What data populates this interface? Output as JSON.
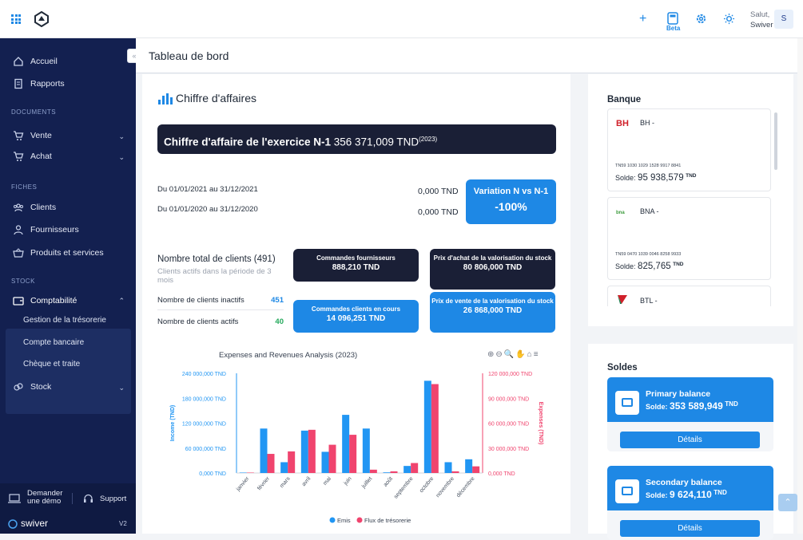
{
  "topbar": {
    "beta_label": "Beta",
    "greeting": "Salut,",
    "user_name": "Swiver",
    "avatar_initial": "S",
    "icons": [
      "apps-grid-icon",
      "swiver-logo",
      "plus-icon",
      "calculator-icon",
      "gear-icon",
      "sun-icon"
    ]
  },
  "sidebar": {
    "accueil": "Accueil",
    "rapports": "Rapports",
    "section_documents": "DOCUMENTS",
    "vente": "Vente",
    "achat": "Achat",
    "section_fiches": "FICHES",
    "clients": "Clients",
    "fournisseurs": "Fournisseurs",
    "produits": "Produits et services",
    "section_stock": "STOCK",
    "comptabilite": "Comptabilité",
    "sub_tresorerie": "Gestion de la trésorerie",
    "sub_compte": "Compte bancaire",
    "sub_cheque": "Chèque et traite",
    "stock": "Stock",
    "demo_line1": "Demander",
    "demo_line2": "une démo",
    "support": "Support",
    "brand": "swiver",
    "version": "V2",
    "collapse_glyph": "«"
  },
  "page": {
    "title": "Tableau de bord"
  },
  "chiffre": {
    "title": "Chiffre d'affaires",
    "banner_label": "Chiffre d'affaire de l'exercice N-1",
    "banner_amount": "356 371,009 TND",
    "banner_year": "(2023)",
    "period1": "Du 01/01/2021 au 31/12/2021",
    "period1_amount": "0,000 TND",
    "period2": "Du 01/01/2020 au 31/12/2020",
    "period2_amount": "0,000 TND",
    "variation_label": "Variation N vs N-1",
    "variation_value": "-100%"
  },
  "clients": {
    "title": "Nombre total de clients (491)",
    "subtitle": "Clients actifs dans la période de 3 mois",
    "inactive_label": "Nombre de clients inactifs",
    "inactive_value": "451",
    "active_label": "Nombre de clients actifs",
    "active_value": "40"
  },
  "kpis": {
    "cmd_fournisseurs_label": "Commandes fournisseurs",
    "cmd_fournisseurs_value": "888,210 TND",
    "prix_achat_label": "Prix d'achat de la valorisation du stock",
    "prix_achat_value": "80 806,000 TND",
    "cmd_clients_label": "Commandes clients en cours",
    "cmd_clients_value": "14 096,251 TND",
    "prix_vente_label": "Prix de vente de la valorisation du stock",
    "prix_vente_value": "26 868,000 TND"
  },
  "chart_tools": "⊕⊖🔍✋⌂≡",
  "chart_data": {
    "type": "bar",
    "title": "Expenses and Revenues Analysis (2023)",
    "categories": [
      "janvier",
      "février",
      "mars",
      "avril",
      "mai",
      "juin",
      "juillet",
      "août",
      "septembre",
      "octobre",
      "novembre",
      "décembre"
    ],
    "series": [
      {
        "name": "Emis",
        "axis": "left",
        "color": "#2196f3",
        "values": [
          1000000,
          107000000,
          26000000,
          102000000,
          51000000,
          140000000,
          107000000,
          1500000,
          17000000,
          222000000,
          26000000,
          33000000
        ]
      },
      {
        "name": "Flux de trésorerie",
        "axis": "right",
        "color": "#f0446e",
        "values": [
          500000,
          23000000,
          26000000,
          52000000,
          34000000,
          46000000,
          4000000,
          2000000,
          12000000,
          107000000,
          2000000,
          8000000
        ]
      }
    ],
    "ylabel": "Income (TND)",
    "y2label": "Expenses (TND)",
    "ylim": [
      0,
      240000000
    ],
    "y2lim": [
      0,
      120000000
    ],
    "yticks": [
      "0,000 TND",
      "60 000,000 TND",
      "120 000,000 TND",
      "180 000,000 TND",
      "240 000,000 TND"
    ],
    "y2ticks": [
      "0,000 TND",
      "30 000,000 TND",
      "60 000,000 TND",
      "90 000,000 TND",
      "120 000,000 TND"
    ],
    "legend": "bottom-center"
  },
  "banque": {
    "title": "Banque",
    "solde_label": "Solde:",
    "tnd": "TND",
    "banks": [
      {
        "logo": "BH",
        "name": "BH -",
        "rib": "TN59 1030 1029 1528 9917 8841",
        "solde": "95 938,579"
      },
      {
        "logo": "bna",
        "name": "BNA -",
        "rib": "TN59 0470 1039 0046 8258 9933",
        "solde": "825,765"
      },
      {
        "logo": "btl",
        "name": "BTL -",
        "rib": "",
        "solde": ""
      }
    ]
  },
  "soldes": {
    "title": "Soldes",
    "solde_label": "Solde:",
    "tnd": "TND",
    "details_label": "Détails",
    "balances": [
      {
        "name": "Primary balance",
        "amount": "353 589,949"
      },
      {
        "name": "Secondary balance",
        "amount": "9 624,110"
      }
    ]
  },
  "colors": {
    "primary": "#1e88e5",
    "sidebar": "#132050",
    "dark": "#1a1f36",
    "income": "#2196f3",
    "expense": "#f0446e",
    "green": "#22a85a"
  }
}
